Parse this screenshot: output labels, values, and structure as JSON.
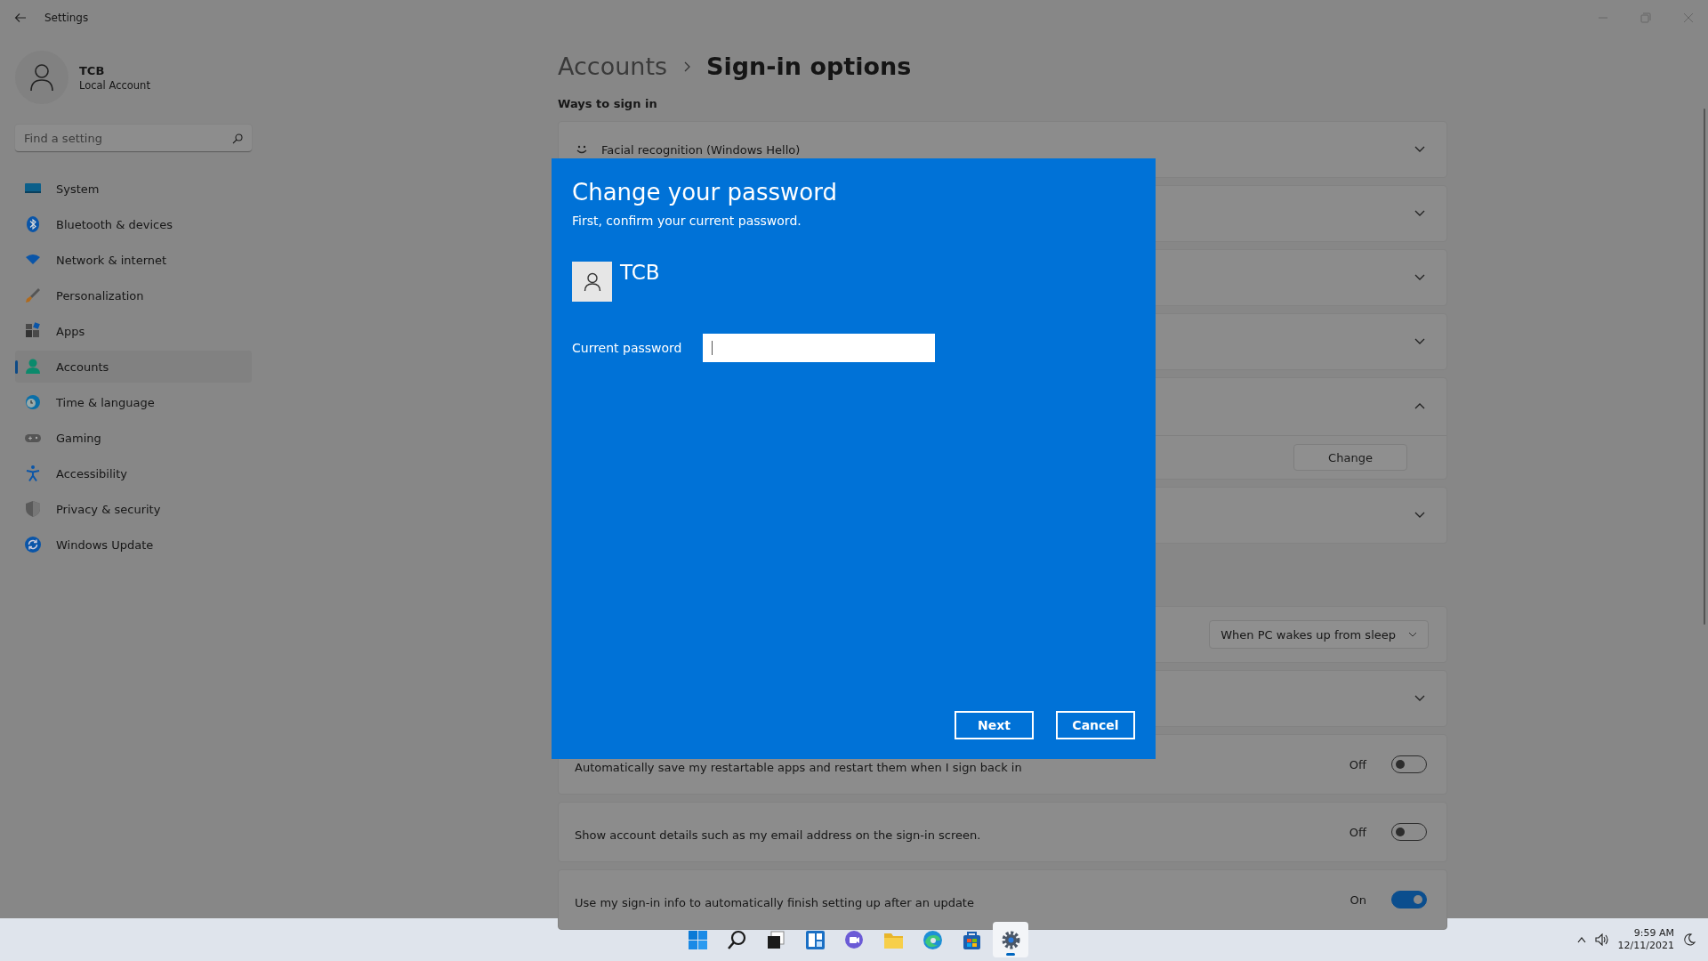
{
  "window": {
    "title": "Settings"
  },
  "account": {
    "name": "TCB",
    "type": "Local Account"
  },
  "search": {
    "placeholder": "Find a setting"
  },
  "nav": [
    {
      "label": "System",
      "selected": false
    },
    {
      "label": "Bluetooth & devices",
      "selected": false
    },
    {
      "label": "Network & internet",
      "selected": false
    },
    {
      "label": "Personalization",
      "selected": false
    },
    {
      "label": "Apps",
      "selected": false
    },
    {
      "label": "Accounts",
      "selected": true
    },
    {
      "label": "Time & language",
      "selected": false
    },
    {
      "label": "Gaming",
      "selected": false
    },
    {
      "label": "Accessibility",
      "selected": false
    },
    {
      "label": "Privacy & security",
      "selected": false
    },
    {
      "label": "Windows Update",
      "selected": false
    }
  ],
  "breadcrumb": {
    "parent": "Accounts",
    "current": "Sign-in options"
  },
  "section_title": "Ways to sign in",
  "cards": [
    {
      "kind": "expander",
      "label": "Facial recognition (Windows Hello)",
      "expanded": false
    },
    {
      "kind": "expander",
      "expanded": false
    },
    {
      "kind": "expander",
      "expanded": false
    },
    {
      "kind": "expander",
      "expanded": false
    },
    {
      "kind": "expander",
      "expanded": true,
      "action": "Change"
    },
    {
      "kind": "expander",
      "expanded": false
    },
    {
      "kind": "dropdown",
      "value": "When PC wakes up from sleep"
    },
    {
      "kind": "expander",
      "expanded": false
    },
    {
      "kind": "toggle",
      "label": "Automatically save my restartable apps and restart them when I sign back in",
      "state_text": "Off",
      "on": false
    },
    {
      "kind": "toggle",
      "label": "Show account details such as my email address on the sign-in screen.",
      "state_text": "Off",
      "on": false
    },
    {
      "kind": "toggle",
      "label": "Use my sign-in info to automatically finish setting up after an update",
      "state_text": "On",
      "on": true
    }
  ],
  "dialog": {
    "title": "Change your password",
    "subtitle": "First, confirm your current password.",
    "user": "TCB",
    "field_label": "Current password",
    "buttons": [
      "Next",
      "Cancel"
    ]
  },
  "taskbar": {
    "apps": [
      {
        "selected": false
      },
      {
        "selected": false
      },
      {
        "selected": false
      },
      {
        "selected": false
      },
      {
        "selected": false
      },
      {
        "selected": false
      },
      {
        "selected": false
      },
      {
        "selected": false
      },
      {
        "selected": true
      }
    ],
    "time": "9:59 AM",
    "date": "12/11/2021"
  }
}
